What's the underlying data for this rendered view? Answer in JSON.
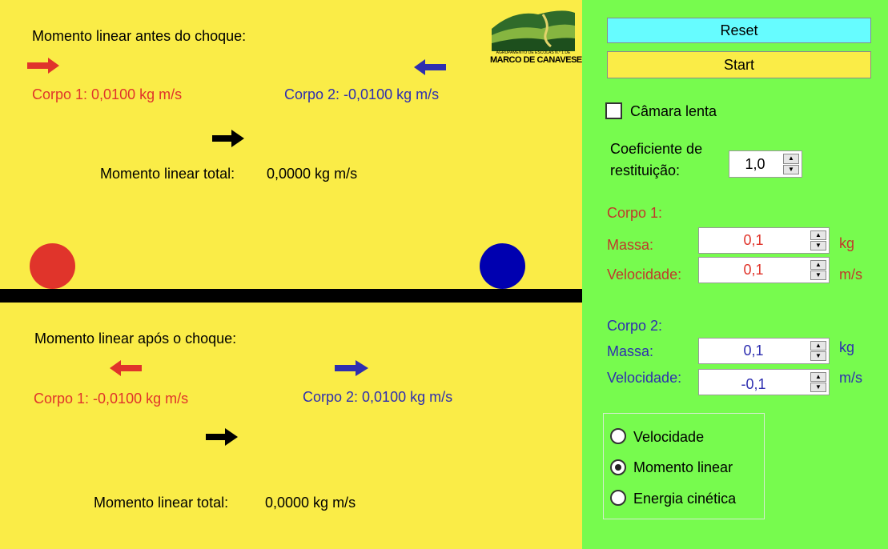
{
  "sim": {
    "before_title": "Momento linear antes do choque:",
    "before_body1": "Corpo 1:  0,0100 kg m/s",
    "before_body2": "Corpo 2:  -0,0100 kg m/s",
    "before_total_label": "Momento linear total:",
    "before_total_value": "0,0000 kg m/s",
    "after_title": "Momento linear após o choque:",
    "after_body1": "Corpo 1: -0,0100 kg m/s",
    "after_body2": "Corpo 2: 0,0100 kg m/s",
    "after_total_label": "Momento linear total:",
    "after_total_value": "0,0000 kg m/s",
    "logo_line1": "AGRUPAMENTO DE ESCOLAS N.º 1 DE",
    "logo_line2": "MARCO DE CANAVESES"
  },
  "colors": {
    "simulation_bg": "#FAEC47",
    "panel_bg": "#77FB4E",
    "body1": "#E0342B",
    "body2": "#2E2EB0",
    "reset_button": "#66FCFF",
    "start_button": "#FAEC47"
  },
  "panel": {
    "reset_label": "Reset",
    "start_label": "Start",
    "slow_camera_label": "Câmara lenta",
    "slow_camera_checked": false,
    "restitution_label_1": "Coeficiente de",
    "restitution_label_2": "restituição:",
    "restitution_value": "1,0",
    "body1": {
      "title": "Corpo 1:",
      "mass_label": "Massa:",
      "mass_value": "0,1",
      "mass_unit": "kg",
      "velocity_label": "Velocidade:",
      "velocity_value": "0,1",
      "velocity_unit": "m/s"
    },
    "body2": {
      "title": "Corpo 2:",
      "mass_label": "Massa:",
      "mass_value": "0,1",
      "mass_unit": "kg",
      "velocity_label": "Velocidade:",
      "velocity_value": "-0,1",
      "velocity_unit": "m/s"
    },
    "display_options": [
      {
        "label": "Velocidade",
        "selected": false
      },
      {
        "label": "Momento linear",
        "selected": true
      },
      {
        "label": "Energia cinética",
        "selected": false
      }
    ]
  }
}
